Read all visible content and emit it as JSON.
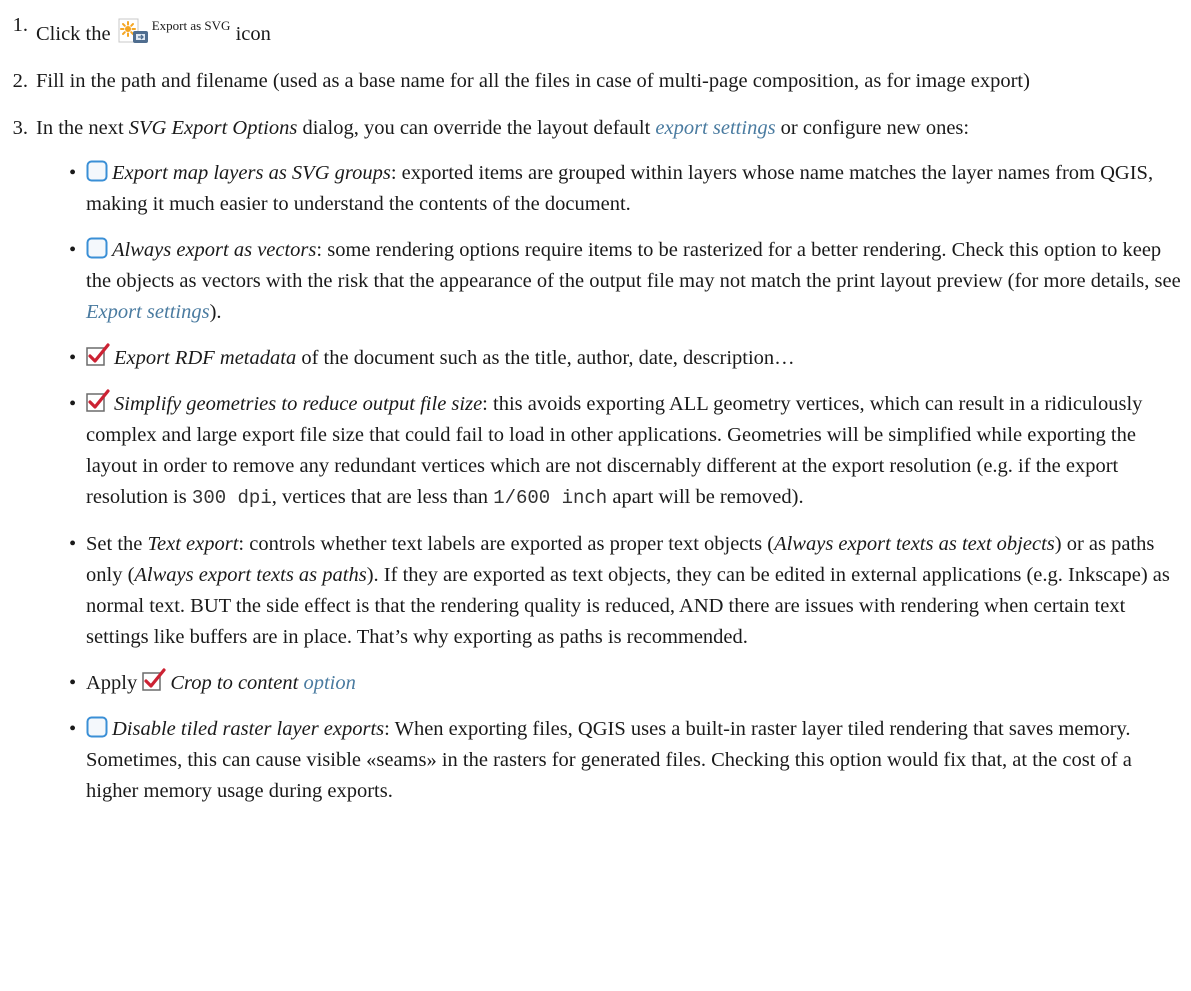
{
  "steps": [
    {
      "number": "1.",
      "text_before": "Click the",
      "icon_label": "Export as SVG",
      "text_after": "icon"
    },
    {
      "number": "2.",
      "text": "Fill in the path and filename (used as a base name for all the files in case of multi-page composition, as for image export)"
    },
    {
      "number": "3.",
      "text_before": "In the next",
      "dialog_name": "SVG Export Options",
      "text_middle": "dialog, you can override the layout default",
      "link": "export settings",
      "text_after": "or configure new ones:"
    }
  ],
  "options": {
    "layers": {
      "title": "Export map layers as SVG groups",
      "text": ": exported items are grouped within layers whose name matches the layer names from QGIS, making it much easier to understand the contents of the document."
    },
    "vectors": {
      "title": "Always export as vectors",
      "text": ": some rendering options require items to be rasterized for a better rendering. Check this option to keep the objects as vectors with the risk that the appearance of the output file may not match the print layout preview (for more details, see",
      "link": "Export settings",
      "text_end": ")."
    },
    "rdf": {
      "title": "Export RDF metadata",
      "text": "of the document such as the title, author, date, description…"
    },
    "simplify": {
      "title": "Simplify geometries to reduce output file size",
      "text_1": ": this avoids exporting ALL geometry vertices, which can result in a ridiculously complex and large export file size that could fail to load in other applications. Geometries will be simplified while exporting the layout in order to remove any redundant vertices which are not discernably different at the export resolution (e.g. if the export resolution is",
      "code_1": "300 dpi",
      "text_2": ", vertices that are less than",
      "code_2": "1/600 inch",
      "text_3": "apart will be removed)."
    },
    "text_export": {
      "prefix": "Set the",
      "title": "Text export",
      "text_1": ": controls whether text labels are exported as proper text objects (",
      "opt_1": "Always export texts as text objects",
      "text_2": ") or as paths only (",
      "opt_2": "Always export texts as paths",
      "text_3": "). If they are exported as text objects, they can be edited in external applications (e.g. Inkscape) as normal text. BUT the side effect is that the rendering quality is reduced, AND there are issues with rendering when certain text settings like buffers are in place. That’s why exporting as paths is recommended."
    },
    "crop": {
      "prefix": "Apply",
      "title": "Crop to content",
      "link": "option"
    },
    "tiled": {
      "title": "Disable tiled raster layer exports",
      "text": ": When exporting files, QGIS uses a built-in raster layer tiled rendering that saves memory. Sometimes, this can cause visible «seams» in the rasters for generated files. Checking this option would fix that, at the cost of a higher memory usage during exports."
    }
  },
  "colors": {
    "link": "#4a7ba0",
    "checkbox_border": "#3a8fd6",
    "checkmark": "#cc2233"
  },
  "icons": {
    "export_svg": "export-svg-icon",
    "unchecked": "checkbox-unchecked-icon",
    "checked": "checkbox-checked-icon"
  }
}
